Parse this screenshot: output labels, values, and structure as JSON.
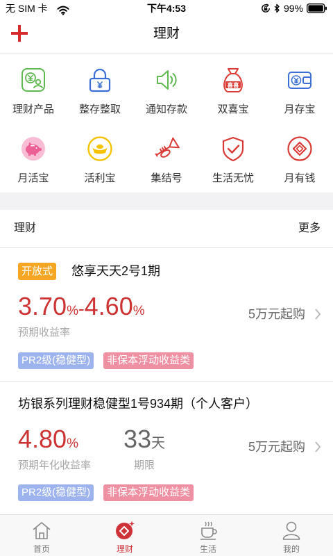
{
  "status_bar": {
    "carrier": "无 SIM 卡",
    "time": "下午4:53",
    "battery": "99%",
    "icons": [
      "wifi-icon",
      "rotation-lock-icon",
      "bluetooth-icon",
      "battery-icon"
    ]
  },
  "nav": {
    "title": "理财",
    "left_icon": "plus-icon"
  },
  "shortcuts": [
    {
      "label": "理财产品",
      "icon": "wealth-product-icon",
      "color": "#5fb84f"
    },
    {
      "label": "整存整取",
      "icon": "lock-icon",
      "color": "#3b6fd6"
    },
    {
      "label": "通知存款",
      "icon": "speaker-icon",
      "color": "#5fb84f"
    },
    {
      "label": "双喜宝",
      "icon": "money-bag-icon",
      "color": "#d93a35",
      "icon_text": "喜喜"
    },
    {
      "label": "月存宝",
      "icon": "wallet-icon",
      "color": "#3b6fd6"
    },
    {
      "label": "月活宝",
      "icon": "piggy-bank-icon",
      "color": "#ec5f97"
    },
    {
      "label": "活利宝",
      "icon": "gold-ingot-icon",
      "color": "#f4c400"
    },
    {
      "label": "集结号",
      "icon": "trumpet-icon",
      "color": "#d93a35"
    },
    {
      "label": "生活无忧",
      "icon": "shield-check-icon",
      "color": "#d93a35"
    },
    {
      "label": "月有钱",
      "icon": "diamond-coin-icon",
      "color": "#d93a35"
    }
  ],
  "section": {
    "title": "理财",
    "more": "更多"
  },
  "products": [
    {
      "badge": "开放式",
      "name": "悠享天天2号1期",
      "rate_low": "3.70",
      "rate_high": "4.60",
      "rate_unit": "%",
      "rate_sep": "-",
      "rate_label": "预期收益率",
      "min_purchase": "5万元起购",
      "tags": [
        "PR2级(稳健型)",
        "非保本浮动收益类"
      ]
    },
    {
      "name": "坊银系列理财稳健型1号934期（个人客户）",
      "rate": "4.80",
      "rate_unit": "%",
      "rate_label": "预期年化收益率",
      "term_value": "33",
      "term_unit": "天",
      "term_label": "期限",
      "min_purchase": "5万元起购",
      "tags": [
        "PR2级(稳健型)",
        "非保本浮动收益类"
      ]
    }
  ],
  "tab_bar": {
    "tabs": [
      {
        "label": "首页",
        "icon": "home-icon",
        "active": false
      },
      {
        "label": "理财",
        "icon": "wealth-icon",
        "active": true
      },
      {
        "label": "生活",
        "icon": "coffee-cup-icon",
        "active": false
      },
      {
        "label": "我的",
        "icon": "user-icon",
        "active": false
      }
    ]
  },
  "colors": {
    "accent_red": "#d0323a",
    "rate_red": "#cd3333",
    "badge_orange": "#f5a623",
    "tag_blue": "#9db3ee",
    "tag_pink": "#ef8fa2"
  }
}
